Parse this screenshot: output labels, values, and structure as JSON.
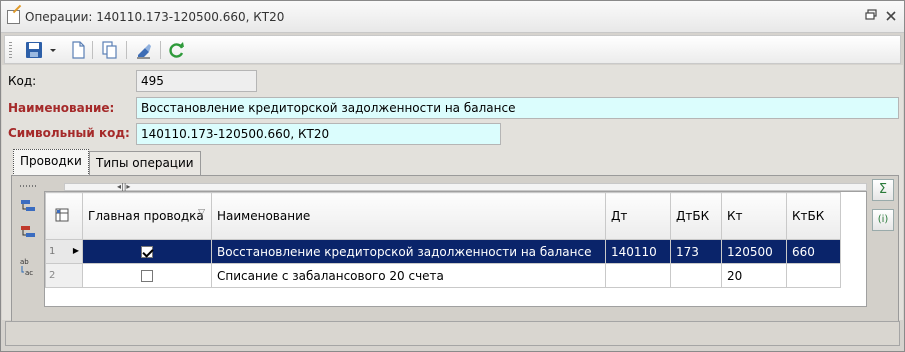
{
  "window": {
    "title": "Операции: 140110.173-120500.660, КТ20"
  },
  "form": {
    "code_label": "Код:",
    "code_value": "495",
    "name_label": "Наименование:",
    "name_value": "Восстановление кредиторской задолженности на балансе",
    "symbol_label": "Символьный код:",
    "symbol_value": "140110.173-120500.660, КТ20"
  },
  "tabs": [
    {
      "label": "Проводки",
      "active": true
    },
    {
      "label": "Типы операции",
      "active": false
    }
  ],
  "grid": {
    "columns": {
      "main": "Главная проводка",
      "name": "Наименование",
      "dt": "Дт",
      "dtbk": "ДтБК",
      "kt": "Кт",
      "ktbk": "КтБК"
    },
    "rows": [
      {
        "num": "1",
        "main": true,
        "name": "Восстановление кредиторской задолженности на балансе",
        "dt": "140110",
        "dtbk": "173",
        "kt": "120500",
        "ktbk": "660",
        "selected": true
      },
      {
        "num": "2",
        "main": false,
        "name": "Списание с забалансового 20 счета",
        "dt": "",
        "dtbk": "",
        "kt": "20",
        "ktbk": "",
        "selected": false
      }
    ]
  },
  "side_tools": {
    "sum_symbol": "Σ",
    "info_symbol": "(i)"
  },
  "colors": {
    "required_label": "#a52a2a",
    "input_cyan": "#dbfdfd",
    "selection": "#0a246a"
  }
}
